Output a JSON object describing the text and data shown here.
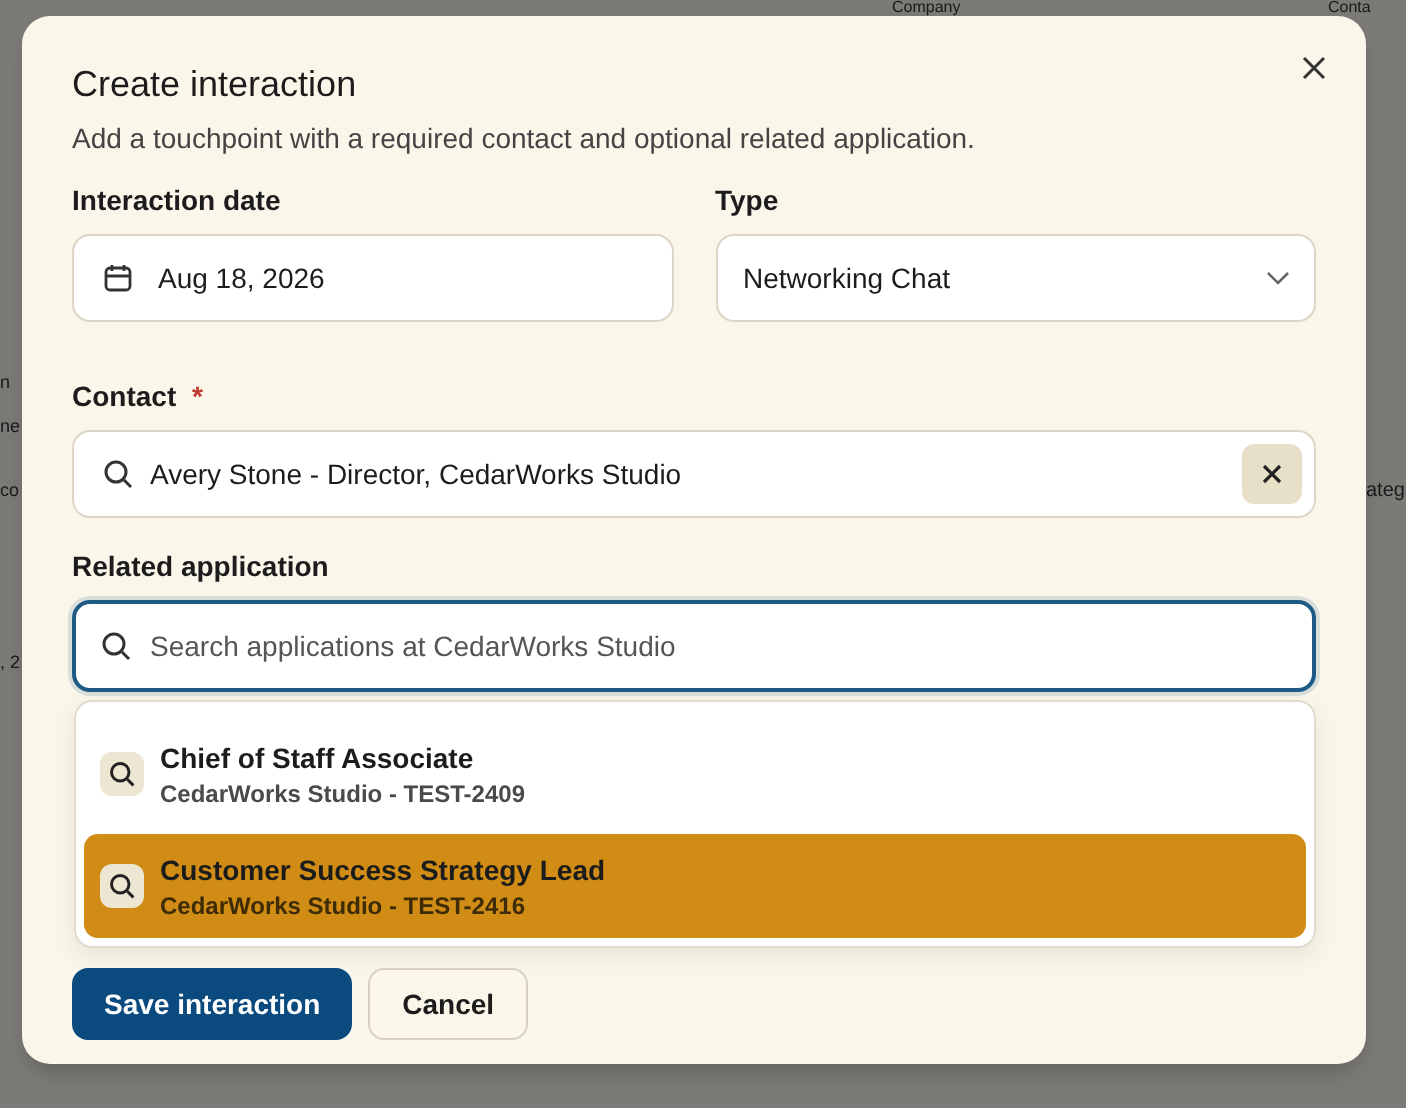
{
  "backdrop": {
    "texts": [
      {
        "text": "Company",
        "kind": "header"
      },
      {
        "text": "Conta",
        "kind": "header"
      },
      {
        "text": "n",
        "kind": "left"
      },
      {
        "text": "ne",
        "kind": "left"
      },
      {
        "text": "co",
        "kind": "left"
      },
      {
        "text": ", 2",
        "kind": "left"
      },
      {
        "text": "ateg",
        "kind": "right"
      }
    ]
  },
  "dialog": {
    "title": "Create interaction",
    "subtitle": "Add a touchpoint with a required contact and optional related application.",
    "date": {
      "label": "Interaction date",
      "value": "Aug 18, 2026"
    },
    "type": {
      "label": "Type",
      "value": "Networking Chat"
    },
    "contact": {
      "label": "Contact",
      "required_mark": "*",
      "value": "Avery Stone - Director, CedarWorks Studio"
    },
    "related": {
      "label": "Related application",
      "placeholder": "Search applications at CedarWorks Studio",
      "focused": true
    },
    "results": [
      {
        "title": "Chief of Staff Associate",
        "subtitle": "CedarWorks Studio - TEST-2409",
        "selected": false
      },
      {
        "title": "Customer Success Strategy Lead",
        "subtitle": "CedarWorks Studio - TEST-2416",
        "selected": true
      }
    ],
    "buttons": [
      {
        "label": "Save interaction",
        "kind": "primary"
      },
      {
        "label": "Cancel",
        "kind": "secondary"
      }
    ]
  }
}
